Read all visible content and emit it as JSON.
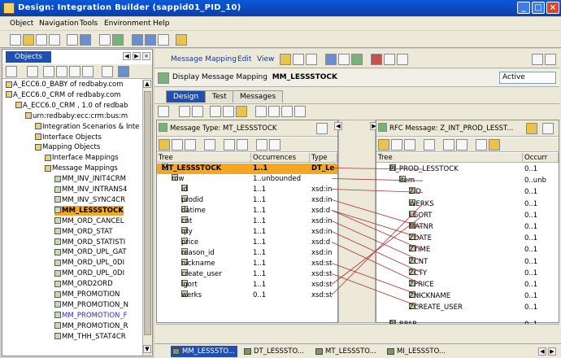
{
  "window": {
    "title": "Design: Integration Builder (sappid01_PID_10)"
  },
  "menu": [
    "Object",
    "Navigation",
    "Tools",
    "Environment",
    "Help"
  ],
  "left_panel": {
    "tab": "Objects",
    "tree": [
      {
        "text": "A_ECC6.0_BABY of redbaby.com",
        "indent": 0
      },
      {
        "text": "A_ECC6.0_CRM of redbaby.com",
        "indent": 0
      },
      {
        "text": "A_ECC6.0_CRM , 1.0 of redbab",
        "indent": 1
      },
      {
        "text": "urn:redbaby:ecc:crm:bus:m",
        "indent": 2
      },
      {
        "text": "Integration Scenarios & Inte",
        "indent": 3
      },
      {
        "text": "Interface Objects",
        "indent": 3
      },
      {
        "text": "Mapping Objects",
        "indent": 3
      },
      {
        "text": "Interface Mappings",
        "indent": 4
      },
      {
        "text": "Message Mappings",
        "indent": 4
      },
      {
        "text": "MM_INV_INIT4CRM",
        "indent": 5
      },
      {
        "text": "MM_INV_INTRANS4",
        "indent": 5
      },
      {
        "text": "MM_INV_SYNC4CR",
        "indent": 5
      },
      {
        "text": "MM_LESSSTOCK",
        "indent": 5,
        "selected": true
      },
      {
        "text": "MM_ORD_CANCEL",
        "indent": 5
      },
      {
        "text": "MM_ORD_STAT",
        "indent": 5
      },
      {
        "text": "MM_ORD_STATISTI",
        "indent": 5
      },
      {
        "text": "MM_ORD_UPL_GAT",
        "indent": 5
      },
      {
        "text": "MM_ORD_UPL_0DI",
        "indent": 5
      },
      {
        "text": "MM_ORD_UPL_0DI",
        "indent": 5
      },
      {
        "text": "MM_ORD2ORD",
        "indent": 5
      },
      {
        "text": "MM_PROMOTION",
        "indent": 5
      },
      {
        "text": "MM_PROMOTION_N",
        "indent": 5
      },
      {
        "text": "MM_PROMOTION_F",
        "indent": 5,
        "blue": true
      },
      {
        "text": "MM_PROMOTION_R",
        "indent": 5
      },
      {
        "text": "MM_THH_STAT4CR",
        "indent": 5
      }
    ]
  },
  "right_toolbar": {
    "message_mapping": "Message Mapping",
    "edit": "Edit",
    "view": "View"
  },
  "display": {
    "title": "Display Message Mapping",
    "name": "MM_LESSSTOCK",
    "status": "Active"
  },
  "tabs": [
    "Design",
    "Test",
    "Messages"
  ],
  "source": {
    "header": "Message Type: MT_LESSSTOCK",
    "columns": [
      "Tree",
      "Occurrences",
      "Type"
    ],
    "rows": [
      {
        "name": "MT_LESSSTOCK",
        "occ": "1..1",
        "type": "DT_Le",
        "indent": 0,
        "selected": true
      },
      {
        "name": "row",
        "occ": "1..unbounded",
        "type": "",
        "indent": 1
      },
      {
        "name": "id",
        "occ": "1..1",
        "type": "xsd:in",
        "indent": 2
      },
      {
        "name": "prodid",
        "occ": "1..1",
        "type": "xsd:in",
        "indent": 2
      },
      {
        "name": "datime",
        "occ": "1..1",
        "type": "xsd:d",
        "indent": 2
      },
      {
        "name": "cnt",
        "occ": "1..1",
        "type": "xsd:in",
        "indent": 2
      },
      {
        "name": "qty",
        "occ": "1..1",
        "type": "xsd:in",
        "indent": 2
      },
      {
        "name": "price",
        "occ": "1..1",
        "type": "xsd:d",
        "indent": 2
      },
      {
        "name": "reason_id",
        "occ": "1..1",
        "type": "xsd:in",
        "indent": 2
      },
      {
        "name": "nickname",
        "occ": "1..1",
        "type": "xsd:st",
        "indent": 2
      },
      {
        "name": "create_user",
        "occ": "1..1",
        "type": "xsd:st",
        "indent": 2
      },
      {
        "name": "lgort",
        "occ": "1..1",
        "type": "xsd:st",
        "indent": 2
      },
      {
        "name": "werks",
        "occ": "0..1",
        "type": "xsd:st",
        "indent": 2
      }
    ]
  },
  "target": {
    "header": "RFC Message: Z_INT_PROD_LESST...",
    "columns": [
      "Tree",
      "Occurr"
    ],
    "rows": [
      {
        "name": "PI_PROD_LESSTOCK",
        "occ": "0..1",
        "indent": 1
      },
      {
        "name": "item",
        "occ": "0..unb",
        "indent": 2
      },
      {
        "name": "ZID",
        "occ": "0..1",
        "indent": 3
      },
      {
        "name": "WERKS",
        "occ": "0..1",
        "indent": 3
      },
      {
        "name": "LGORT",
        "occ": "0..1",
        "indent": 3
      },
      {
        "name": "MATNR",
        "occ": "0..1",
        "indent": 3
      },
      {
        "name": "ZDATE",
        "occ": "0..1",
        "indent": 3
      },
      {
        "name": "ZTIME",
        "occ": "0..1",
        "indent": 3
      },
      {
        "name": "ZCNT",
        "occ": "0..1",
        "indent": 3
      },
      {
        "name": "ZCTY",
        "occ": "0..1",
        "indent": 3
      },
      {
        "name": "ZPRICE",
        "occ": "0..1",
        "indent": 3
      },
      {
        "name": "ZNICKNAME",
        "occ": "0..1",
        "indent": 3
      },
      {
        "name": "ZCREATE_USER",
        "occ": "0..1",
        "indent": 3
      },
      {
        "name": "PI_RPAR",
        "occ": "0..1",
        "indent": 1
      }
    ]
  },
  "bottom_tabs": [
    "MM_LESSSTO...",
    "DT_LESSSTO...",
    "MT_LESSSTO...",
    "MI_LESSSTO..."
  ],
  "colors": {
    "selection": "#f5a623",
    "accent": "#1f4fb0",
    "mapping_line": "#b03030"
  }
}
